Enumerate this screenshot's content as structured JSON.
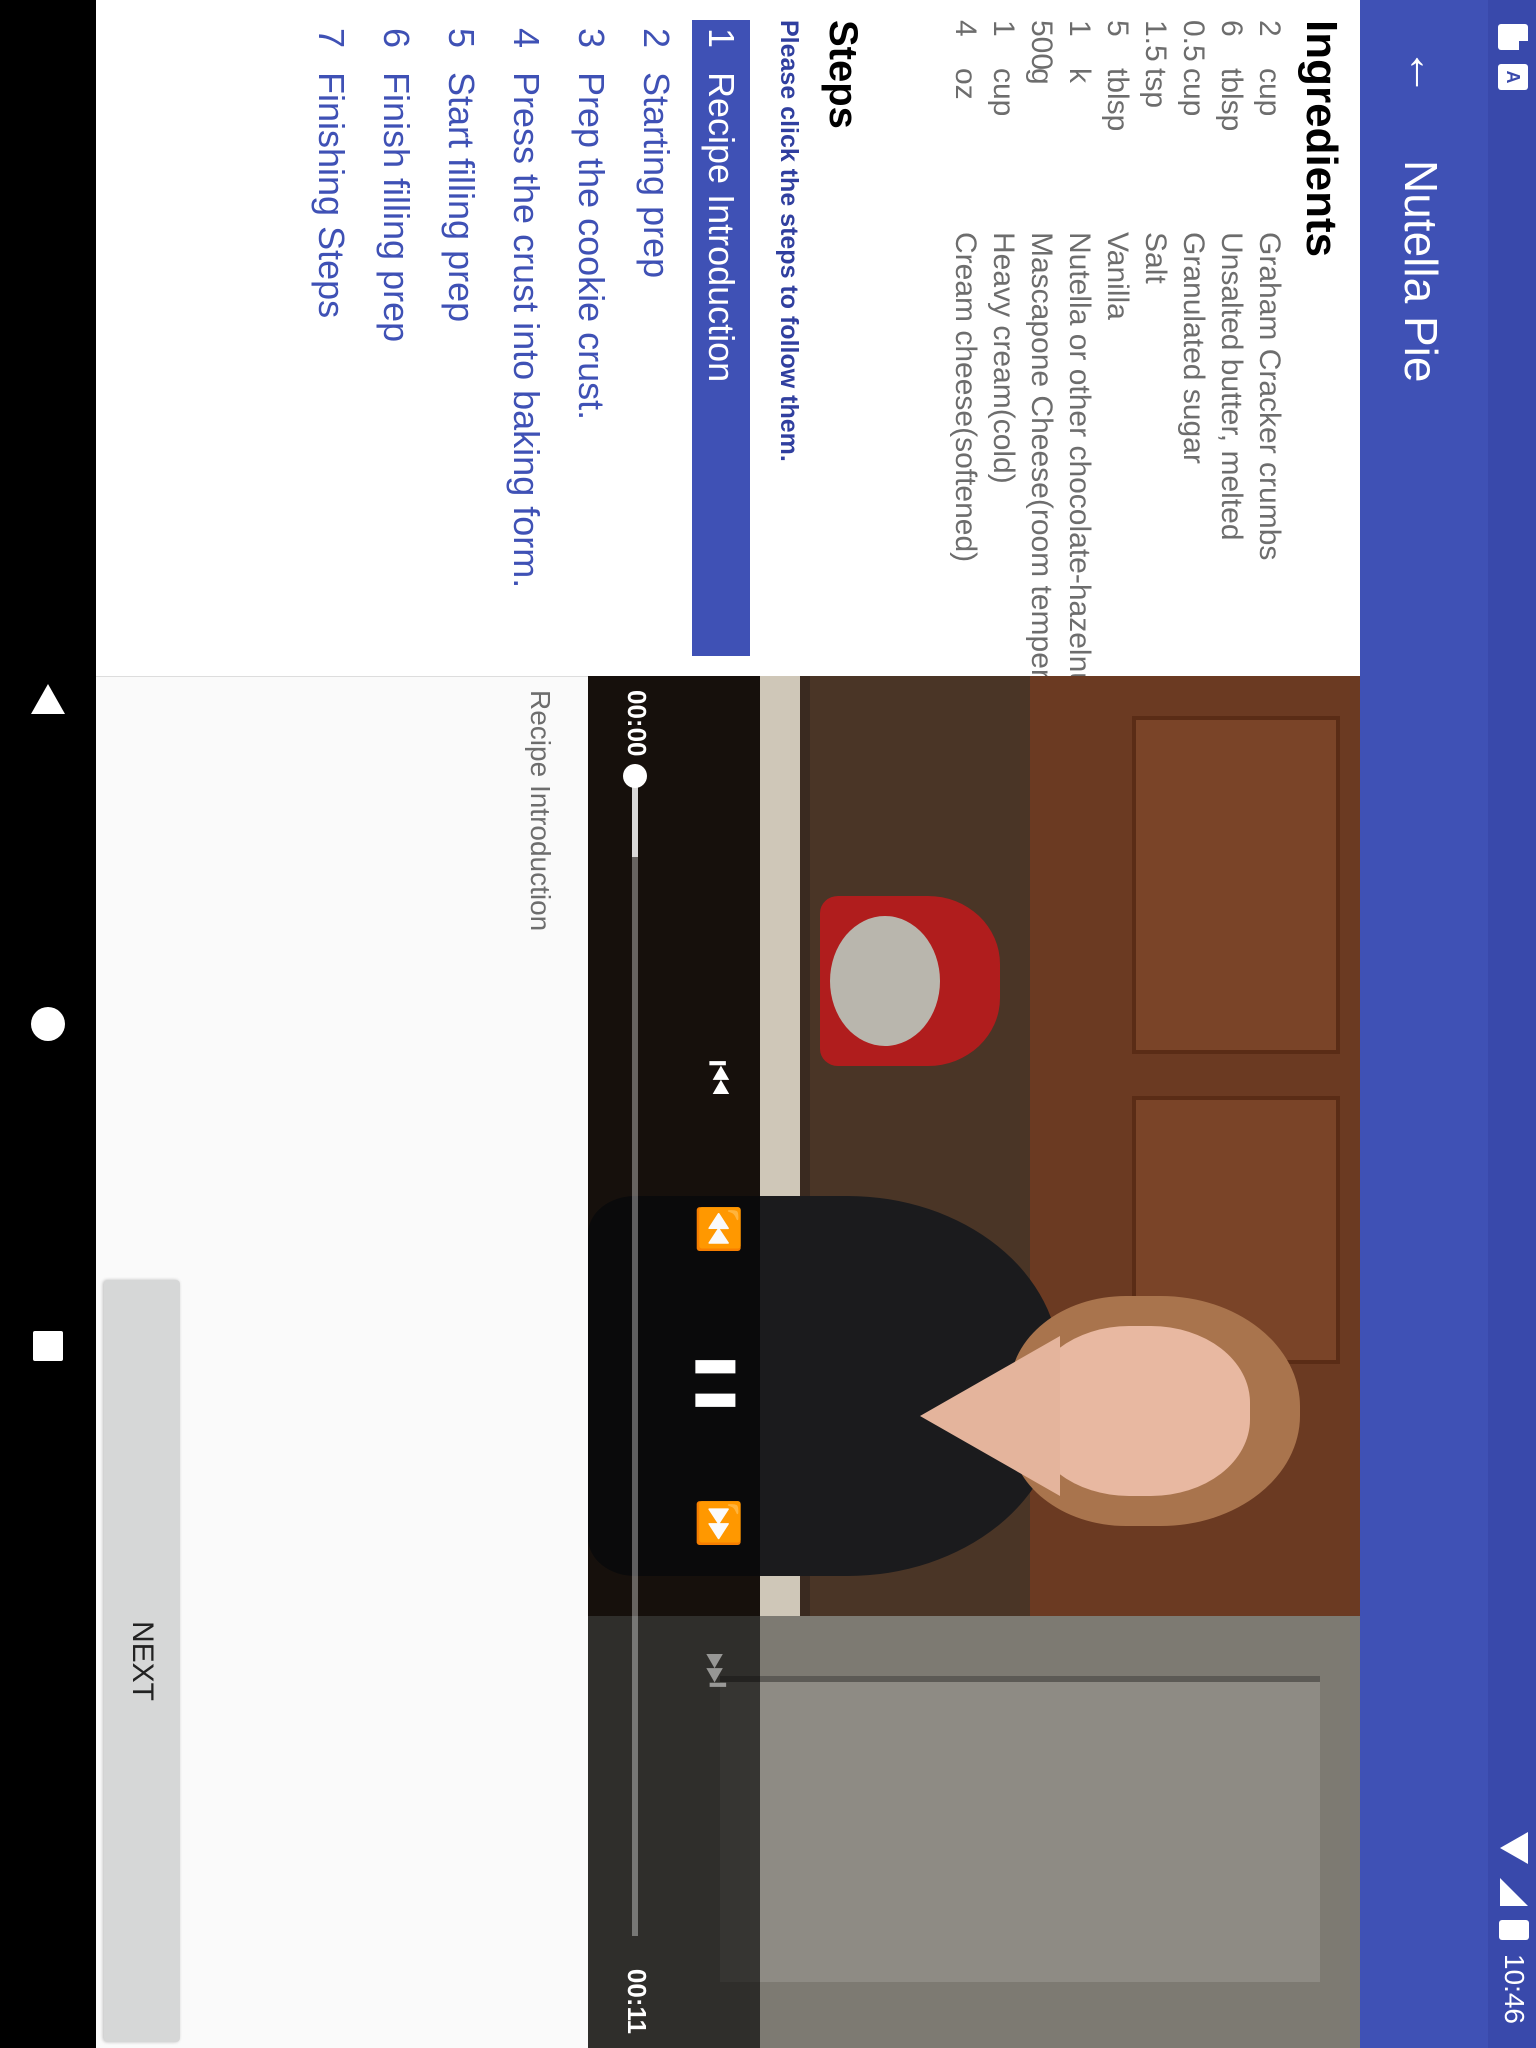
{
  "status_bar": {
    "time": "10:46",
    "notification_icons": [
      "sd-card-icon",
      "a-icon"
    ],
    "status_icons": [
      "wifi-icon",
      "signal-icon",
      "battery-icon"
    ]
  },
  "app_bar": {
    "title": "Nutella Pie",
    "back_icon": "arrow-back-icon"
  },
  "ingredients": {
    "heading": "Ingredients",
    "items": [
      {
        "quantity": "2",
        "measure": "cup",
        "name": "Graham Cracker crumbs"
      },
      {
        "quantity": "6",
        "measure": "tblsp",
        "name": "Unsalted butter, melted"
      },
      {
        "quantity": "0.5",
        "measure": "cup",
        "name": "Granulated sugar"
      },
      {
        "quantity": "1.5",
        "measure": "tsp",
        "name": "Salt"
      },
      {
        "quantity": "5",
        "measure": "tblsp",
        "name": "Vanilla"
      },
      {
        "quantity": "1",
        "measure": "k",
        "name": "Nutella or other chocolate-hazelnu"
      },
      {
        "quantity": "500",
        "measure": "g",
        "name": "Mascapone Cheese(room tempera"
      },
      {
        "quantity": "1",
        "measure": "cup",
        "name": "Heavy cream(cold)"
      },
      {
        "quantity": "4",
        "measure": "oz",
        "name": "Cream cheese(softened)"
      }
    ]
  },
  "steps": {
    "heading": "Steps",
    "hint": "Please click the steps to follow them.",
    "selected_index": 0,
    "items": [
      {
        "number": "1",
        "label": "Recipe Introduction"
      },
      {
        "number": "2",
        "label": "Starting prep"
      },
      {
        "number": "3",
        "label": "Prep the cookie crust."
      },
      {
        "number": "4",
        "label": "Press the crust into baking form."
      },
      {
        "number": "5",
        "label": "Start filling prep"
      },
      {
        "number": "6",
        "label": "Finish filling prep"
      },
      {
        "number": "7",
        "label": "Finishing Steps"
      }
    ]
  },
  "player": {
    "current_time": "00:00",
    "duration": "00:11",
    "progress_fraction": 0.0,
    "buffered_fraction": 0.07,
    "state": "playing",
    "controls": [
      "skip-previous-icon",
      "rewind-icon",
      "pause-icon",
      "fast-forward-icon",
      "skip-next-icon"
    ]
  },
  "step_detail": {
    "description": "Recipe Introduction"
  },
  "actions": {
    "next_label": "NEXT"
  },
  "colors": {
    "primary": "#3f51b5",
    "primary_dark": "#3949ab",
    "hint": "#303f9f",
    "ingredient_text": "#6d6d6d"
  }
}
